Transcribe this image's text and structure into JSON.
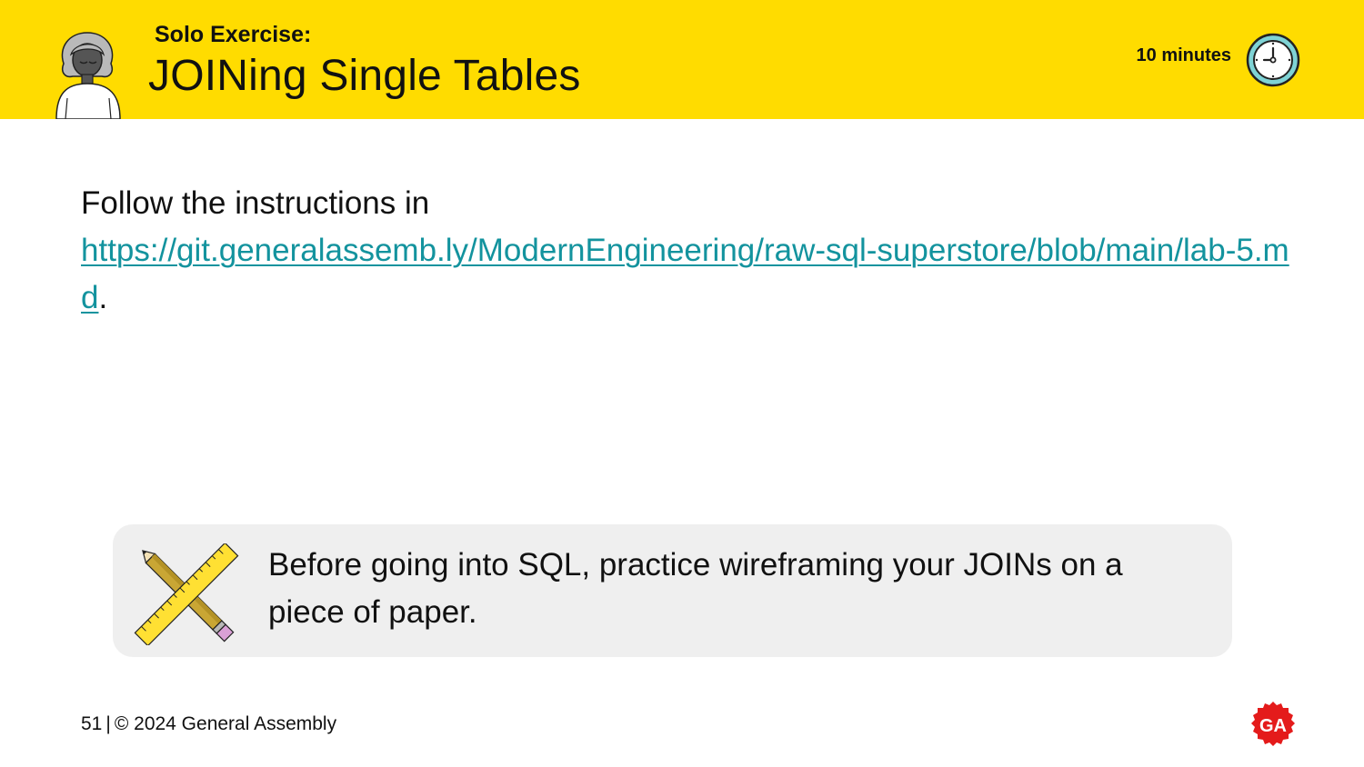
{
  "header": {
    "eyebrow": "Solo Exercise:",
    "title": "JOINing Single Tables",
    "duration": "10 minutes",
    "person_icon": "person-illustration",
    "clock_icon": "clock-icon"
  },
  "body": {
    "intro": "Follow the instructions in",
    "link": "https://git.generalassemb.ly/ModernEngineering/raw-sql-superstore/blob/main/lab-5.md",
    "trailing": "."
  },
  "tip": {
    "icon": "pencil-ruler-icon",
    "text": "Before going into SQL, practice wireframing your JOINs on a piece of paper."
  },
  "footer": {
    "page_number": "51",
    "separator": "|",
    "copyright": "© 2024 General Assembly",
    "logo_text": "GA"
  },
  "colors": {
    "header_bg": "#FFDC00",
    "link": "#13939E",
    "tip_bg": "#EFEFEF",
    "logo_red": "#E41B1B",
    "clock_teal": "#7FD3D5"
  }
}
